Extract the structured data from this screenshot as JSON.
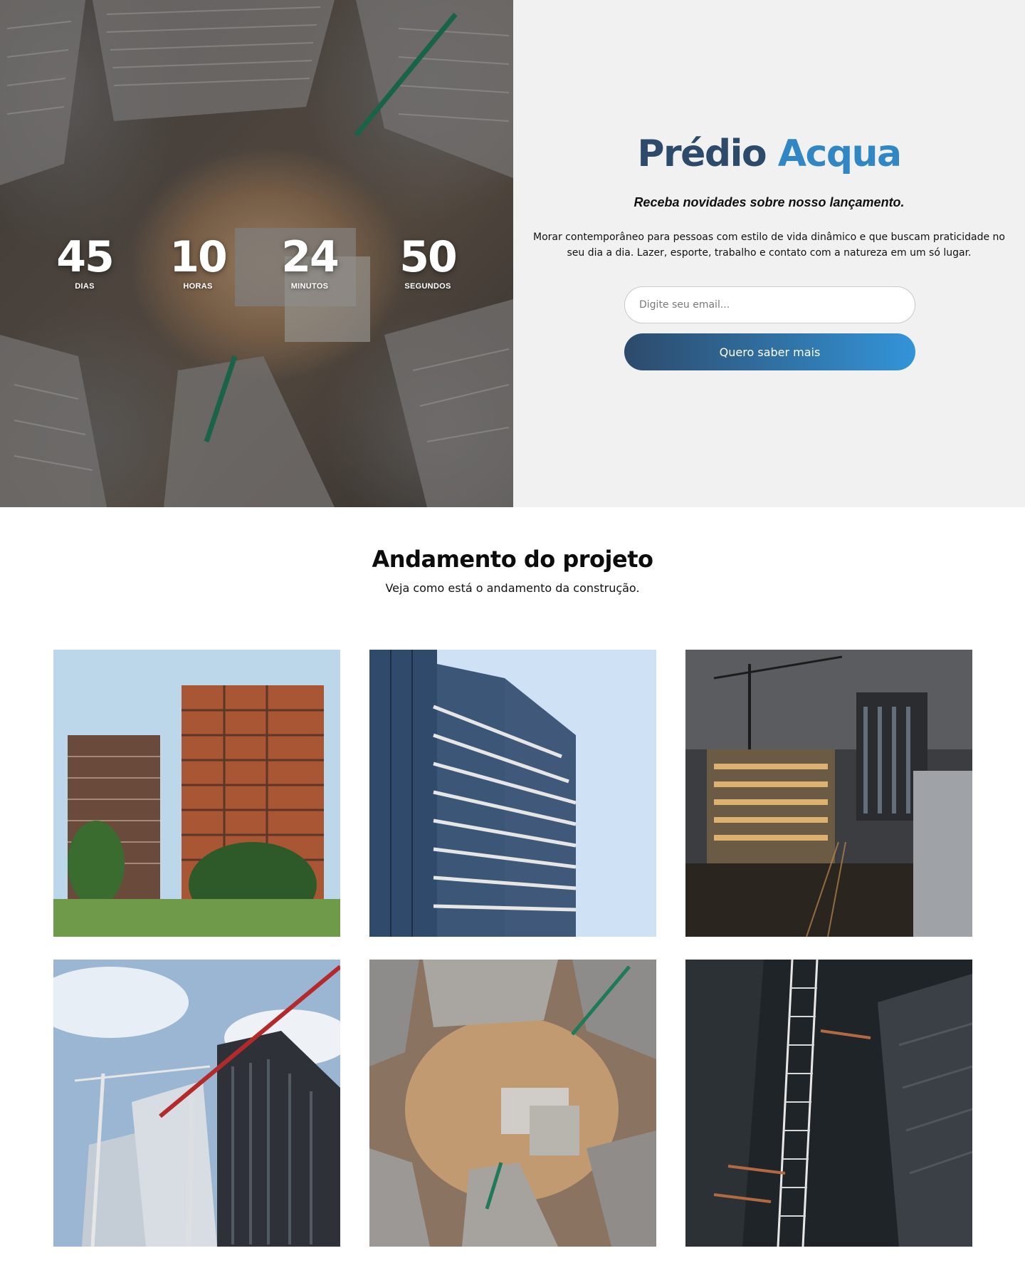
{
  "hero": {
    "countdown": [
      {
        "value": "45",
        "label": "DIAS"
      },
      {
        "value": "10",
        "label": "HORAS"
      },
      {
        "value": "24",
        "label": "MINUTOS"
      },
      {
        "value": "50",
        "label": "SEGUNDOS"
      }
    ],
    "title_part1": "Prédio",
    "title_part2": "Acqua",
    "subtitle": "Receba novidades sobre nosso lançamento.",
    "description": "Morar contemporâneo para pessoas com estilo de vida dinâmico e que buscam praticidade no seu dia a dia. Lazer, esporte, trabalho e contato com a natureza em um só lugar.",
    "email_placeholder": "Digite seu email...",
    "cta_label": "Quero saber mais",
    "colors": {
      "title_dark": "#2d4a6a",
      "title_light": "#3187c4",
      "panel_bg": "#f1f1f1"
    }
  },
  "progress": {
    "title": "Andamento do projeto",
    "subtitle": "Veja como está o andamento da construção.",
    "photos": [
      {
        "name": "brick-towers-photo"
      },
      {
        "name": "glass-tower-photo"
      },
      {
        "name": "night-construction-photo"
      },
      {
        "name": "crane-skyscraper-photo"
      },
      {
        "name": "aerial-site-photo"
      },
      {
        "name": "scaffold-aerial-photo"
      }
    ]
  }
}
